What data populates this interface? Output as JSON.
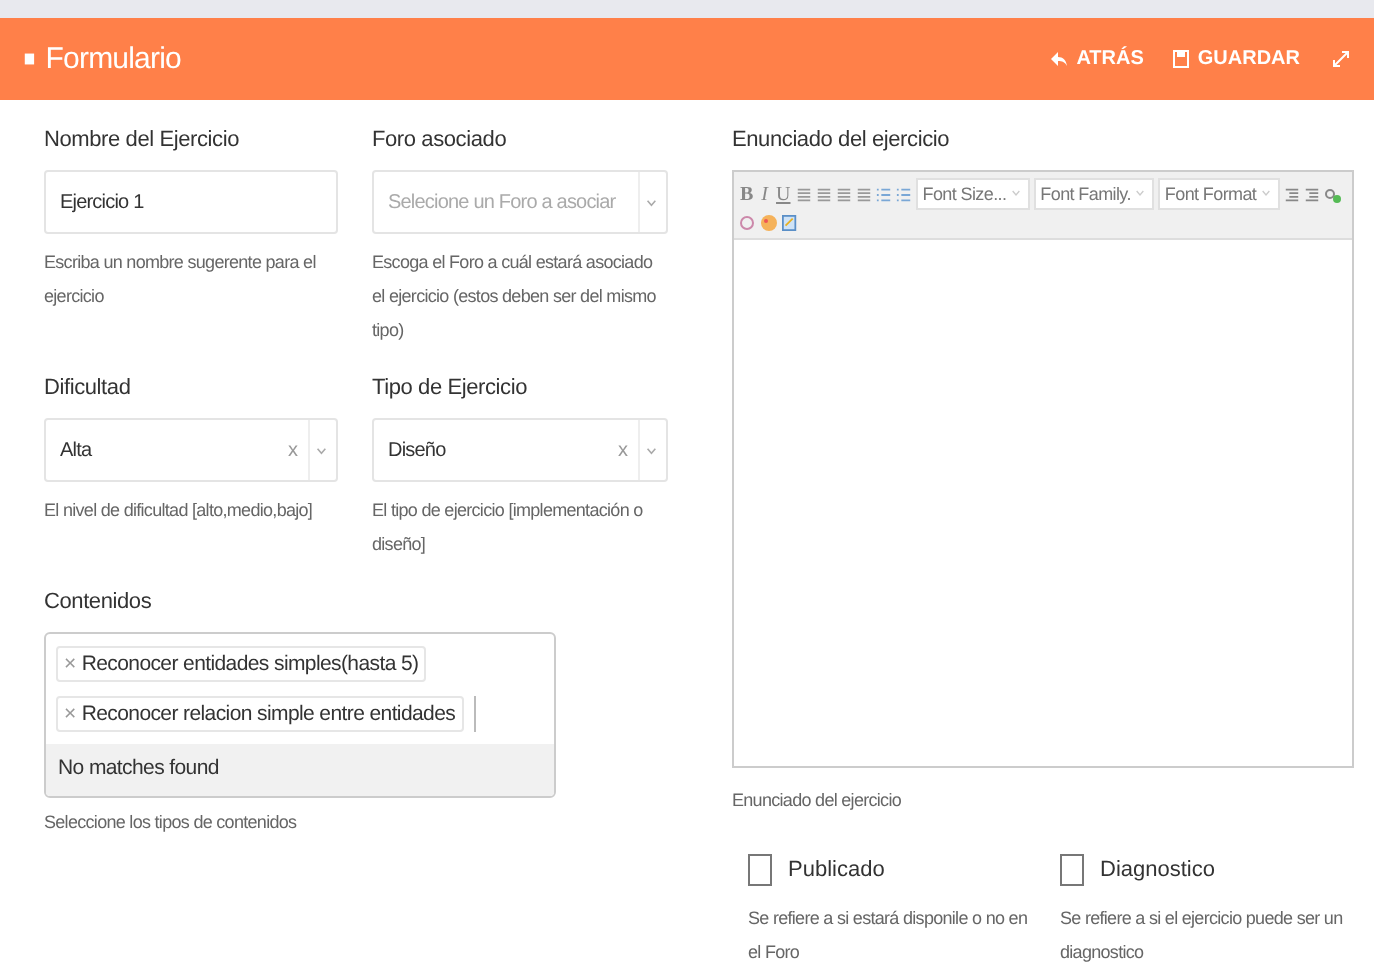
{
  "header": {
    "title": "Formulario",
    "actions": [
      {
        "label": "ATRÁS",
        "kind": "back"
      },
      {
        "label": "GUARDAR",
        "kind": "save"
      }
    ]
  },
  "fields": [
    {
      "label": "Nombre del Ejercicio",
      "kind": "text",
      "value": "Ejercicio 1",
      "help": "Escriba un nombre sugerente para el ejercicio"
    },
    {
      "label": "Foro asociado",
      "kind": "select",
      "placeholder": "Selecione un Foro a asociar",
      "help": "Escoga el Foro a cuál estará asociado el ejercicio (estos deben ser del mismo tipo)"
    },
    {
      "label": "Dificultad",
      "kind": "select",
      "value": "Alta",
      "clear": "x",
      "help": "El nivel de dificultad [alto,medio,bajo]"
    },
    {
      "label": "Tipo de Ejercicio",
      "kind": "select",
      "value": "Diseño",
      "clear": "x",
      "help": "El tipo de ejercicio [implementación o diseño]"
    }
  ],
  "contenidos": {
    "label": "Contenidos",
    "tags": [
      {
        "remove": "×",
        "text": "Reconocer entidades simples(hasta 5)"
      },
      {
        "remove": "×",
        "text": "Reconocer relacion simple entre entidades"
      }
    ],
    "message": "No matches found",
    "help": "Seleccione los tipos de contenidos"
  },
  "editor": {
    "label": "Enunciado del ejercicio",
    "format_buttons": [
      "B",
      "I",
      "U"
    ],
    "dropdowns": [
      "Font Size...",
      "Font Family.",
      "Font Format"
    ],
    "help": "Enunciado del ejercicio"
  },
  "checkboxes": [
    {
      "label": "Publicado",
      "checked": false,
      "help": "Se refiere a si estará disponile o no en el Foro"
    },
    {
      "label": "Diagnostico",
      "checked": false,
      "help": "Se refiere a si el ejercicio puede ser un diagnostico"
    }
  ]
}
